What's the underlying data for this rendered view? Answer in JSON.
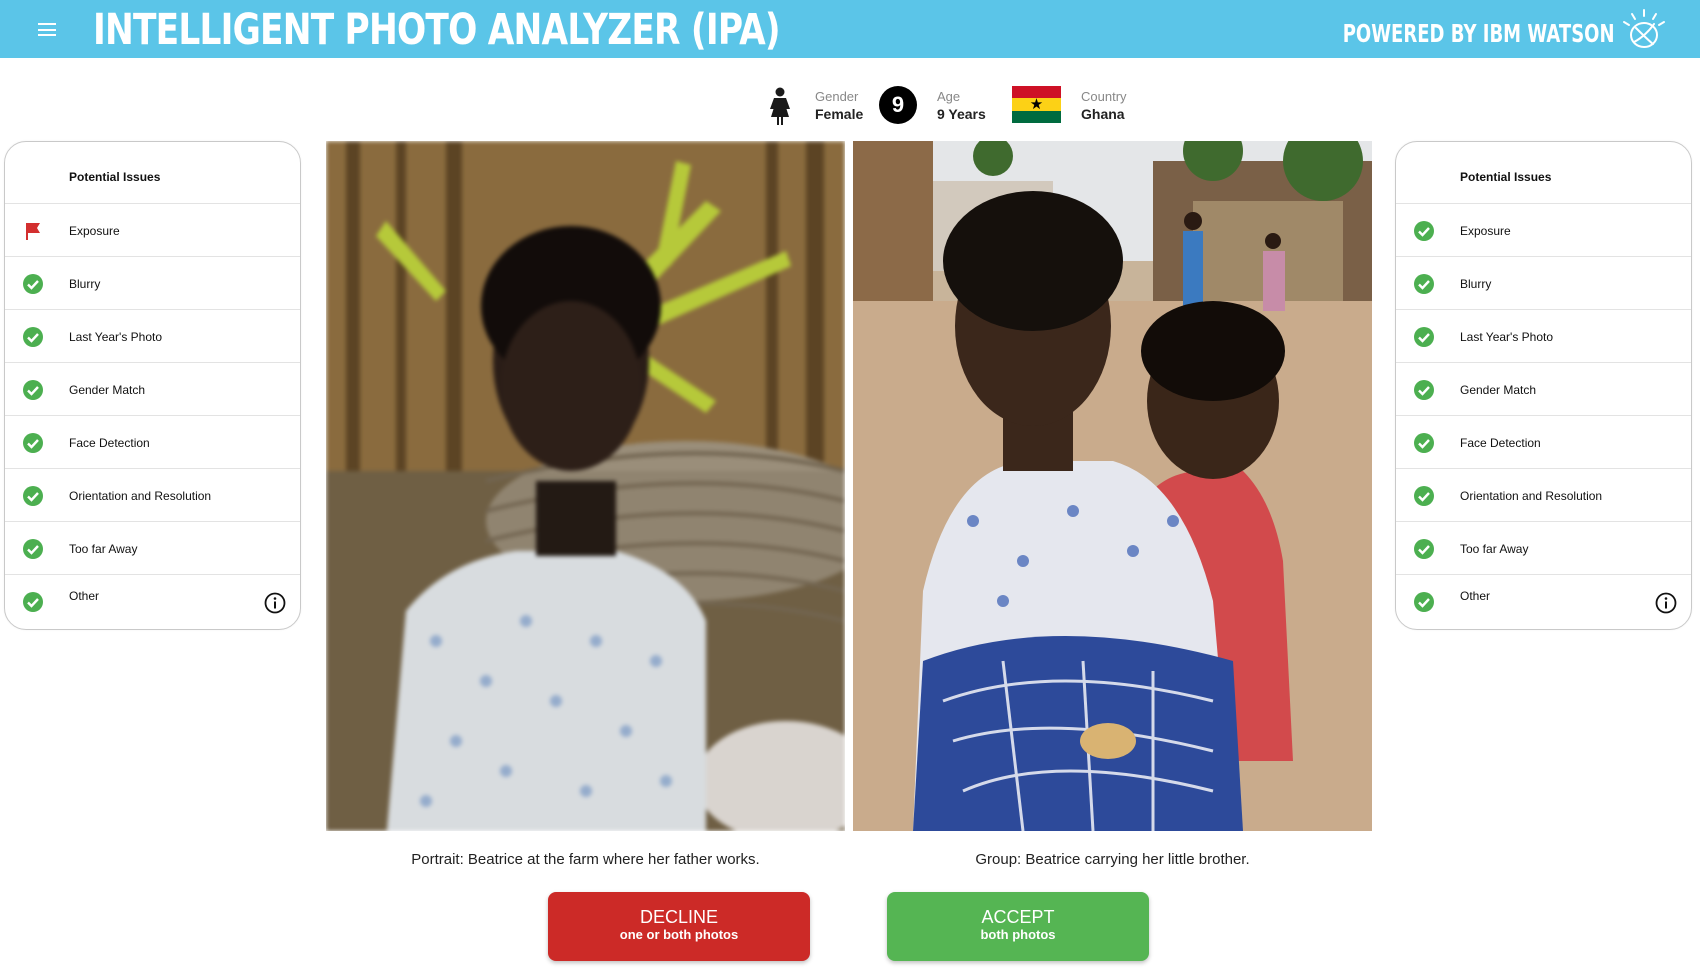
{
  "header": {
    "title": "INTELLIGENT PHOTO ANALYZER (IPA)",
    "powered_by": "POWERED BY IBM WATSON",
    "menu_icon": "hamburger-menu-icon",
    "brand_icon": "ibm-watson-logo-icon"
  },
  "profile": {
    "gender_label": "Gender",
    "gender_value": "Female",
    "age_badge": "9",
    "age_label": "Age",
    "age_value": "9 Years",
    "country_label": "Country",
    "country_value": "Ghana",
    "flag_colors": [
      "#ce1126",
      "#fcd116",
      "#006b3f"
    ]
  },
  "left_panel": {
    "title": "Potential Issues",
    "items": [
      {
        "label": "Exposure",
        "status": "flag"
      },
      {
        "label": "Blurry",
        "status": "ok"
      },
      {
        "label": "Last Year's Photo",
        "status": "ok"
      },
      {
        "label": "Gender Match",
        "status": "ok"
      },
      {
        "label": "Face Detection",
        "status": "ok"
      },
      {
        "label": "Orientation and Resolution",
        "status": "ok"
      },
      {
        "label": "Too far Away",
        "status": "ok"
      },
      {
        "label": "Other",
        "status": "ok"
      }
    ]
  },
  "right_panel": {
    "title": "Potential Issues",
    "items": [
      {
        "label": "Exposure",
        "status": "ok"
      },
      {
        "label": "Blurry",
        "status": "ok"
      },
      {
        "label": "Last Year's Photo",
        "status": "ok"
      },
      {
        "label": "Gender Match",
        "status": "ok"
      },
      {
        "label": "Face Detection",
        "status": "ok"
      },
      {
        "label": "Orientation and Resolution",
        "status": "ok"
      },
      {
        "label": "Too far Away",
        "status": "ok"
      },
      {
        "label": "Other",
        "status": "ok"
      }
    ]
  },
  "photos": {
    "portrait_caption": "Portrait: Beatrice at the farm where her father works.",
    "group_caption": "Group: Beatrice carrying her little brother."
  },
  "actions": {
    "decline_label": "DECLINE",
    "decline_sub": "one or both photos",
    "accept_label": "ACCEPT",
    "accept_sub": "both photos"
  },
  "colors": {
    "header": "#5bc5e8",
    "ok": "#4caf50",
    "flag": "#d32f2f",
    "decline": "#cc2a27",
    "accept": "#55b553"
  }
}
